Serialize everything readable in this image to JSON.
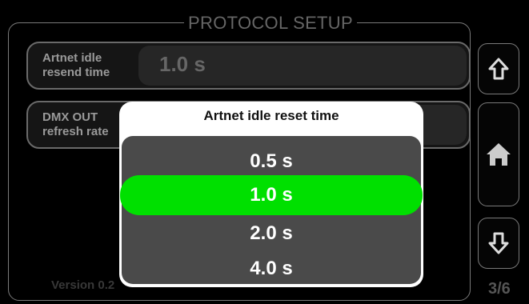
{
  "header": {
    "title": "PROTOCOL SETUP"
  },
  "settings": [
    {
      "label": "Artnet idle resend time",
      "label_line1": "Artnet idle",
      "label_line2": "resend time",
      "value": "1.0 s"
    },
    {
      "label": "DMX OUT refresh rate",
      "label_line1": "DMX OUT",
      "label_line2": "refresh rate",
      "value": ""
    }
  ],
  "footer": {
    "version": "Version 0.2",
    "page": "3/6"
  },
  "modal": {
    "title": "Artnet idle reset time",
    "options": [
      "0.5 s",
      "1.0 s",
      "2.0 s",
      "4.0 s"
    ],
    "selected": "1.0 s"
  },
  "nav": {
    "up_icon": "arrow-up-icon",
    "home_icon": "home-icon",
    "down_icon": "arrow-down-icon"
  },
  "colors": {
    "background": "#000000",
    "selected": "#00e000",
    "modal_background": "#ffffff",
    "options_background": "#4a4a4a"
  }
}
